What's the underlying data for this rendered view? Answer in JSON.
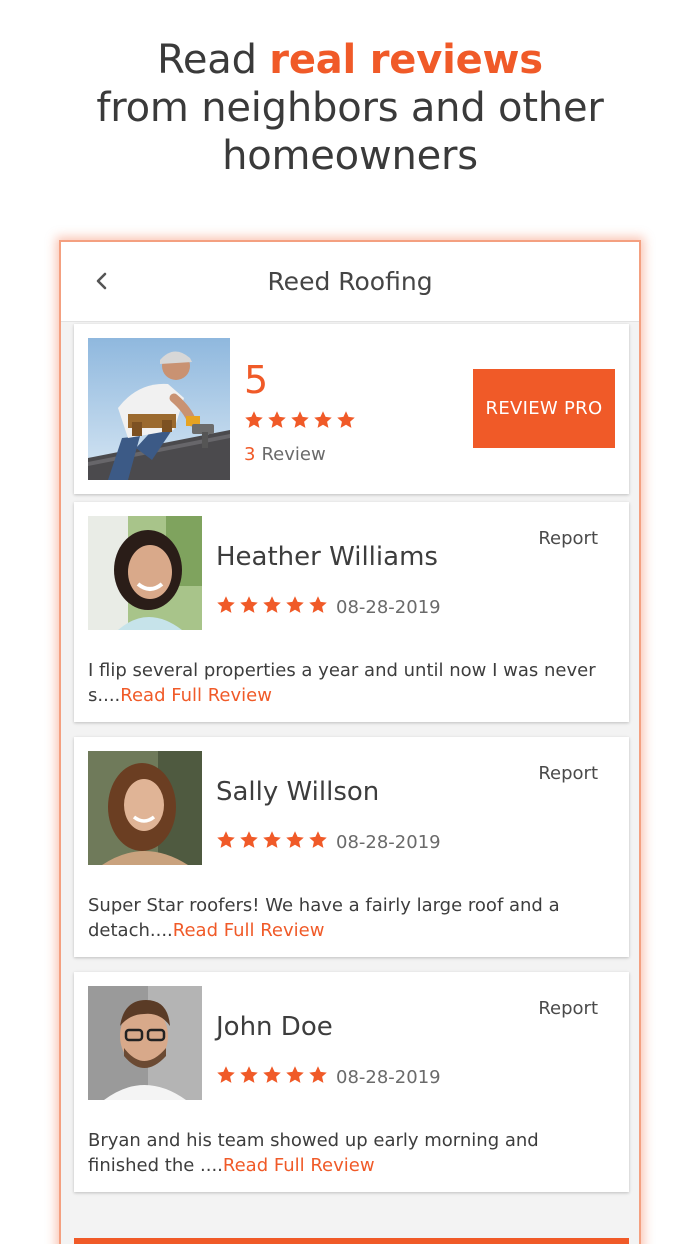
{
  "headline": {
    "prefix": "Read ",
    "accent": "real reviews",
    "line2": "from neighbors and other",
    "line3": "homeowners"
  },
  "topbar": {
    "title": "Reed Roofing"
  },
  "pro": {
    "score": "5",
    "rating_stars": 5,
    "review_count": "3",
    "review_word": "Review",
    "button_label": "REVIEW PRO"
  },
  "reviews": [
    {
      "name": "Heather Williams",
      "report_label": "Report",
      "rating_stars": 5,
      "date": "08-28-2019",
      "text": "I flip several properties a year and until now I was never s....",
      "link": "Read Full Review"
    },
    {
      "name": "Sally Willson",
      "report_label": "Report",
      "rating_stars": 5,
      "date": "08-28-2019",
      "text": "Super Star roofers! We have a fairly large roof and a detach....",
      "link": "Read Full Review"
    },
    {
      "name": "John Doe",
      "report_label": "Report",
      "rating_stars": 5,
      "date": "08-28-2019",
      "text": "Bryan and his team showed up early morning and finished the ....",
      "link": "Read Full Review"
    }
  ],
  "colors": {
    "accent": "#f05a28",
    "text": "#3d3d3d",
    "muted": "#6a6a6a",
    "card_bg": "#ffffff",
    "screen_bg": "#f3f3f3"
  }
}
